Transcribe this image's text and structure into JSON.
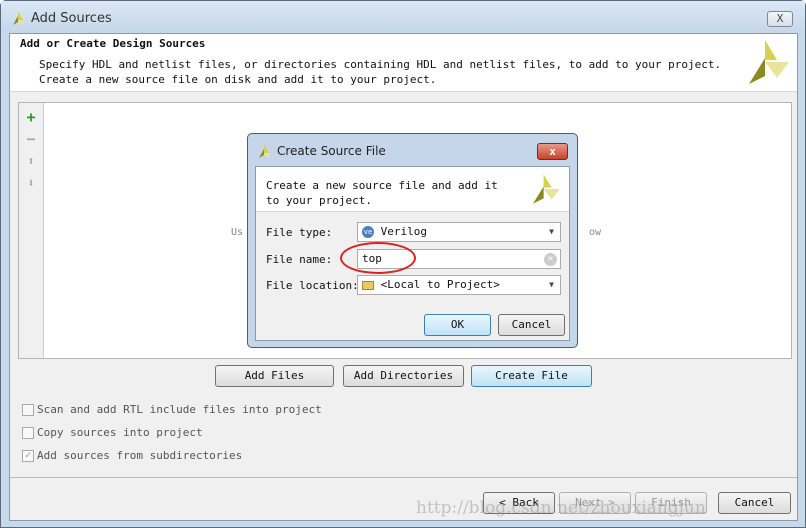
{
  "window": {
    "title": "Add Sources",
    "close_label": "X"
  },
  "header": {
    "title": "Add or Create Design Sources",
    "description": "Specify HDL and netlist files, or directories containing HDL and netlist files, to add to your project. Create a new source file on disk and add it to your project."
  },
  "list": {
    "hint_left": "Us",
    "hint_right": "ow"
  },
  "tools": [
    {
      "icon": "plus-icon",
      "symbol": "+"
    },
    {
      "icon": "minus-icon",
      "symbol": "−"
    },
    {
      "icon": "arrow-up-icon",
      "symbol": "⬆"
    },
    {
      "icon": "arrow-down-icon",
      "symbol": "⬇"
    }
  ],
  "buttons": {
    "add_files": "Add Files",
    "add_directories": "Add Directories",
    "create_file": "Create File"
  },
  "options": [
    {
      "label": "Scan and add RTL include files into project",
      "checked": false
    },
    {
      "label": "Copy sources into project",
      "checked": false
    },
    {
      "label": "Add sources from subdirectories",
      "checked": true
    }
  ],
  "footer": {
    "back": "< Back",
    "next": "Next >",
    "finish": "Finish",
    "cancel": "Cancel"
  },
  "watermark": "http://blog.csdn.net/zhouxiangjun",
  "dialog": {
    "title": "Create Source File",
    "description": "Create a new source file and add it to your project.",
    "file_type_label": "File type:",
    "file_type_value": "Verilog",
    "file_type_icon": "ve",
    "file_name_label": "File name:",
    "file_name_value": "top",
    "file_location_label": "File location:",
    "file_location_value": "<Local to Project>",
    "ok": "OK",
    "cancel": "Cancel",
    "close_label": "x"
  },
  "colors": {
    "logo": "#c8c04a",
    "accent_ring": "#dd2222",
    "add": "#2a9a2a"
  }
}
